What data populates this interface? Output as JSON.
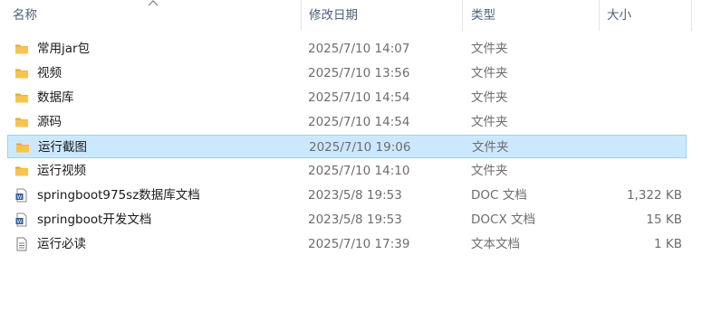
{
  "columns": {
    "name": "名称",
    "modified": "修改日期",
    "type": "类型",
    "size": "大小"
  },
  "files": [
    {
      "name": "常用jar包",
      "modified": "2025/7/10 14:07",
      "type": "文件夹",
      "size": "",
      "icon": "folder-icon",
      "selected": false
    },
    {
      "name": "视频",
      "modified": "2025/7/10 13:56",
      "type": "文件夹",
      "size": "",
      "icon": "folder-icon",
      "selected": false
    },
    {
      "name": "数据库",
      "modified": "2025/7/10 14:54",
      "type": "文件夹",
      "size": "",
      "icon": "folder-icon",
      "selected": false
    },
    {
      "name": "源码",
      "modified": "2025/7/10 14:54",
      "type": "文件夹",
      "size": "",
      "icon": "folder-icon",
      "selected": false
    },
    {
      "name": "运行截图",
      "modified": "2025/7/10 19:06",
      "type": "文件夹",
      "size": "",
      "icon": "folder-icon",
      "selected": true
    },
    {
      "name": "运行视频",
      "modified": "2025/7/10 14:10",
      "type": "文件夹",
      "size": "",
      "icon": "folder-icon",
      "selected": false
    },
    {
      "name": "springboot975sz数据库文档",
      "modified": "2023/5/8 19:53",
      "type": "DOC 文档",
      "size": "1,322 KB",
      "icon": "word-doc-icon",
      "selected": false
    },
    {
      "name": "springboot开发文档",
      "modified": "2023/5/8 19:53",
      "type": "DOCX 文档",
      "size": "15 KB",
      "icon": "word-docx-icon",
      "selected": false
    },
    {
      "name": "运行必读",
      "modified": "2025/7/10 17:39",
      "type": "文本文档",
      "size": "1 KB",
      "icon": "text-file-icon",
      "selected": false
    }
  ],
  "colors": {
    "selection_bg": "#cce8ff",
    "selection_border": "#99d1ff",
    "folder_yellow": "#f8c44f",
    "word_blue": "#2b579a",
    "header_text": "#4c607a"
  }
}
